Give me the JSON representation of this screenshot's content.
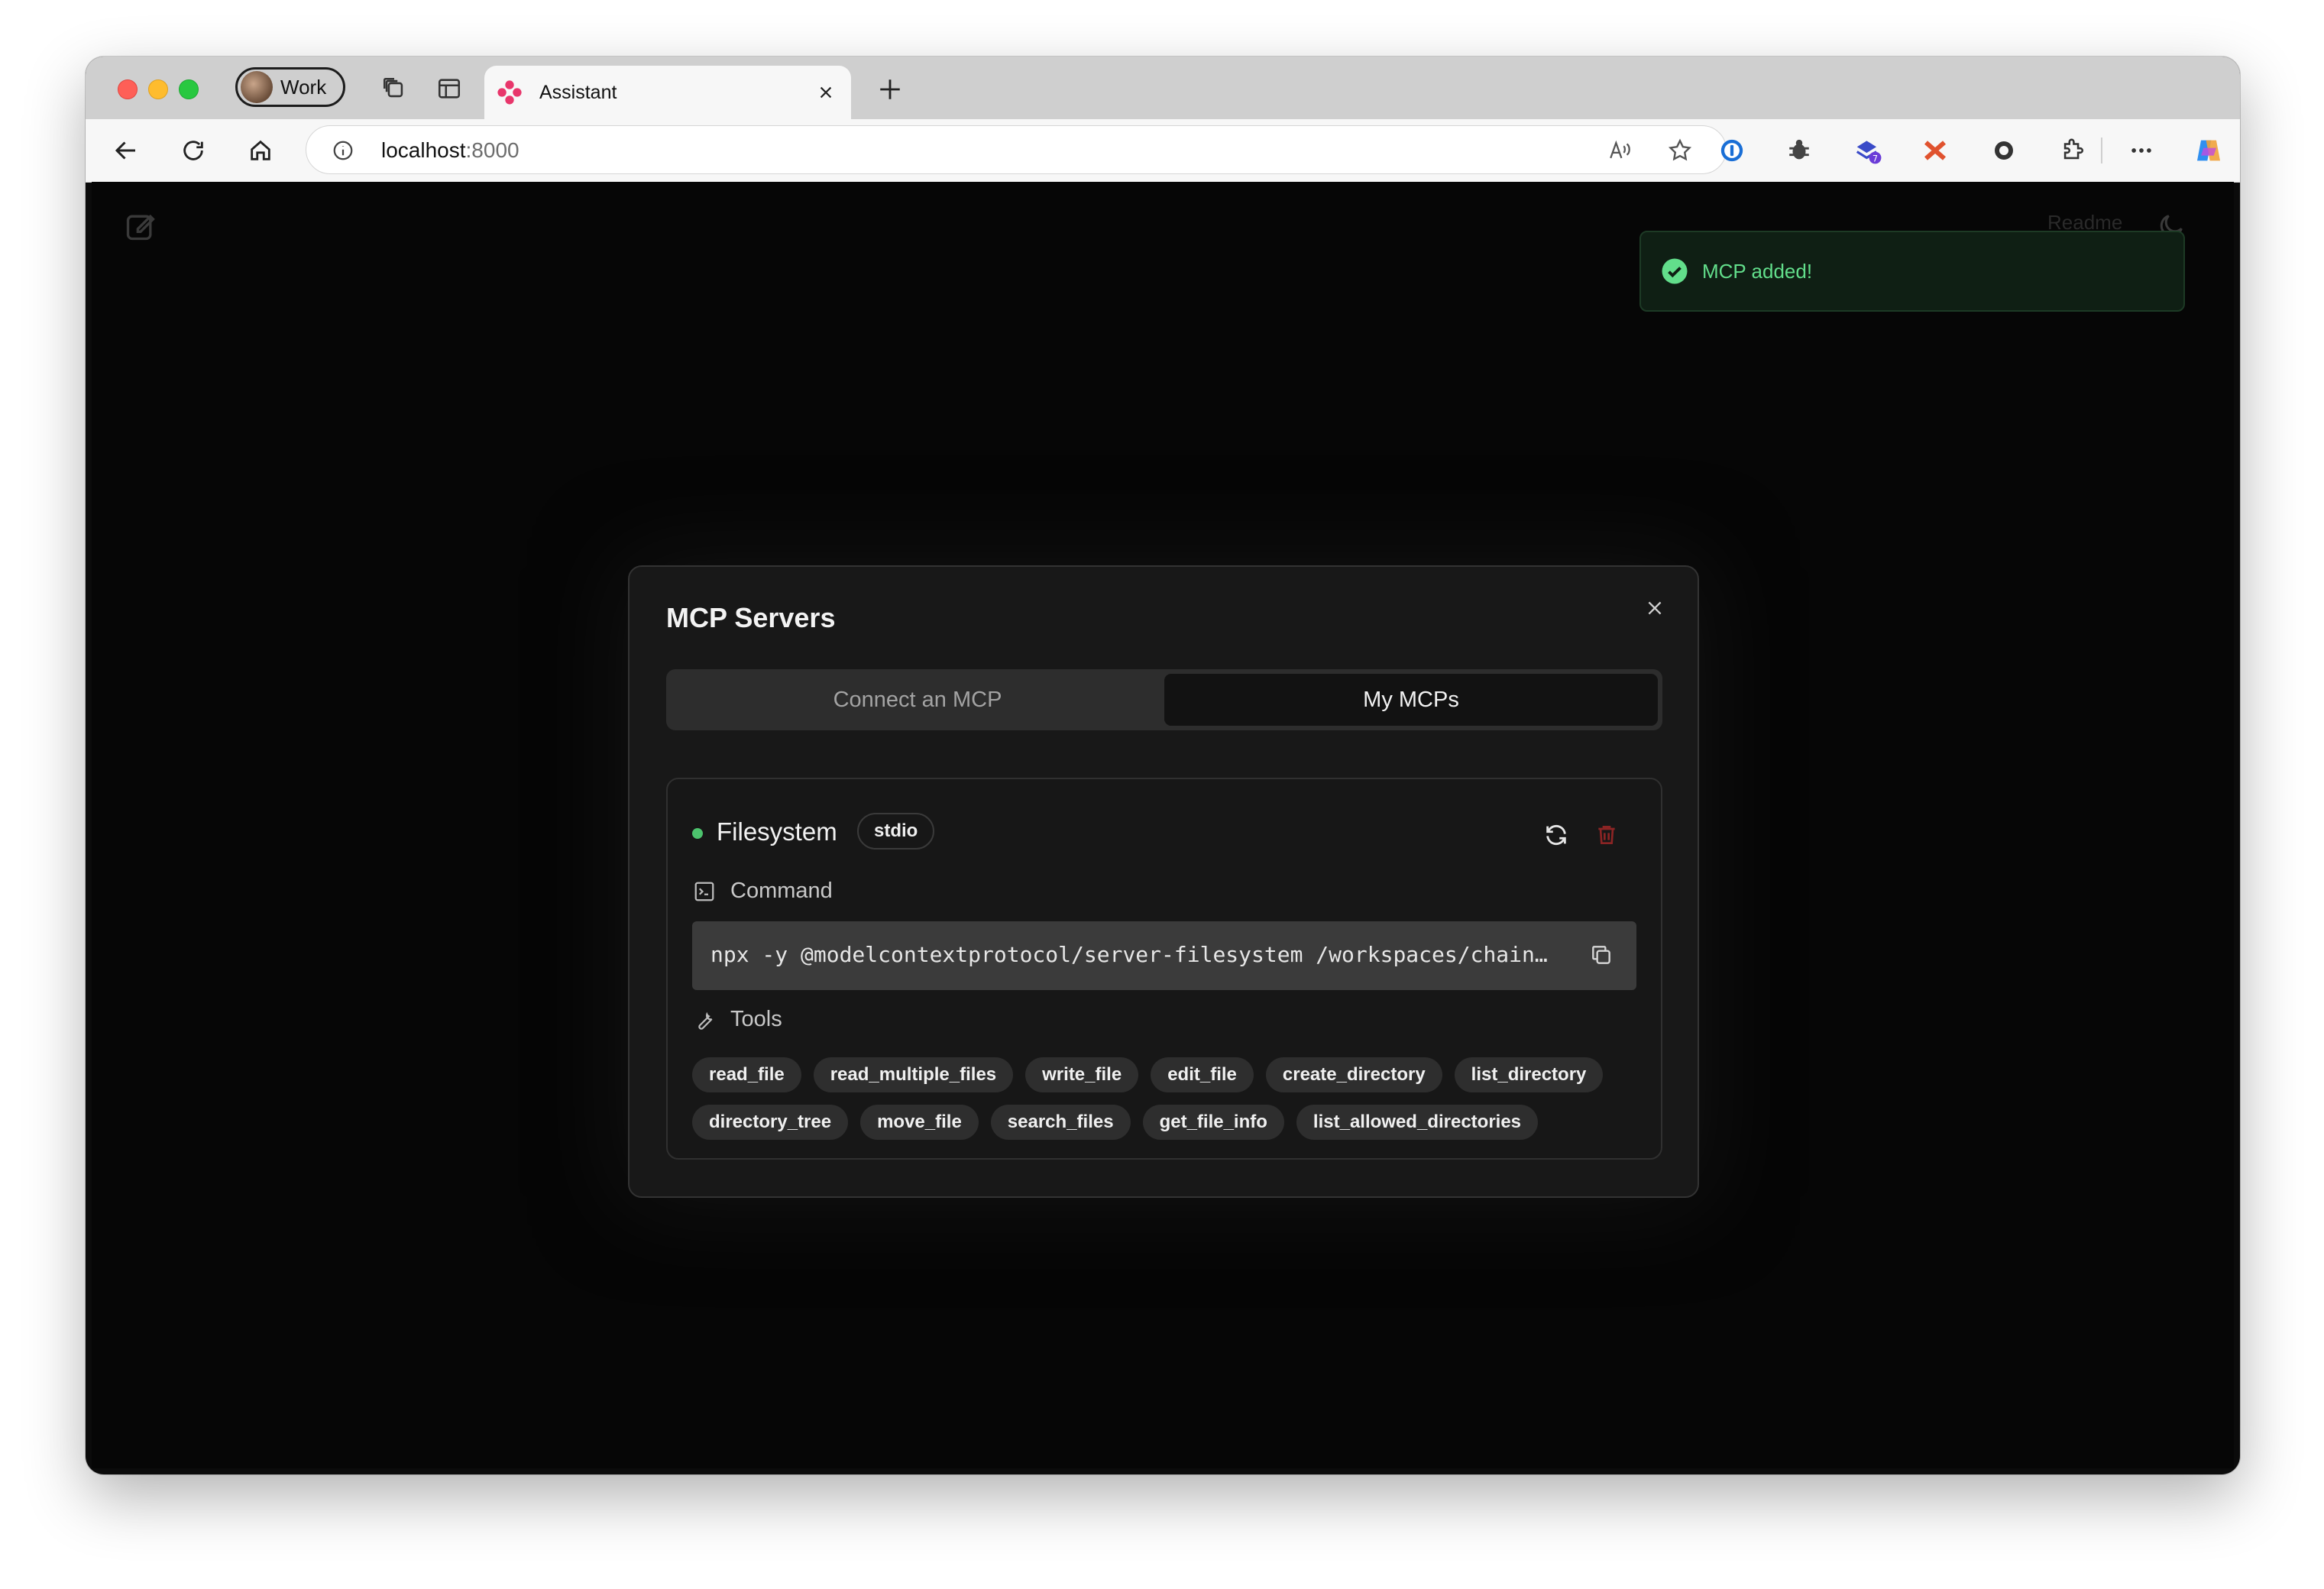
{
  "browser": {
    "profile_label": "Work",
    "tab_title": "Assistant",
    "address_host": "localhost",
    "address_port": ":8000"
  },
  "page": {
    "readme_link": "Readme"
  },
  "toast": {
    "message": "MCP added!"
  },
  "modal": {
    "title": "MCP Servers",
    "tabs": [
      {
        "label": "Connect an MCP",
        "active": false
      },
      {
        "label": "My MCPs",
        "active": true
      }
    ],
    "server": {
      "name": "Filesystem",
      "transport": "stdio",
      "status_color": "#4cc36d",
      "command_label": "Command",
      "command": "npx -y @modelcontextprotocol/server-filesystem /workspaces/chain…",
      "tools_label": "Tools",
      "tools": [
        "read_file",
        "read_multiple_files",
        "write_file",
        "edit_file",
        "create_directory",
        "list_directory",
        "directory_tree",
        "move_file",
        "search_files",
        "get_file_info",
        "list_allowed_directories"
      ]
    }
  },
  "colors": {
    "toast_text": "#62de8b",
    "delete_icon": "#8b2424",
    "background": "#060606"
  }
}
